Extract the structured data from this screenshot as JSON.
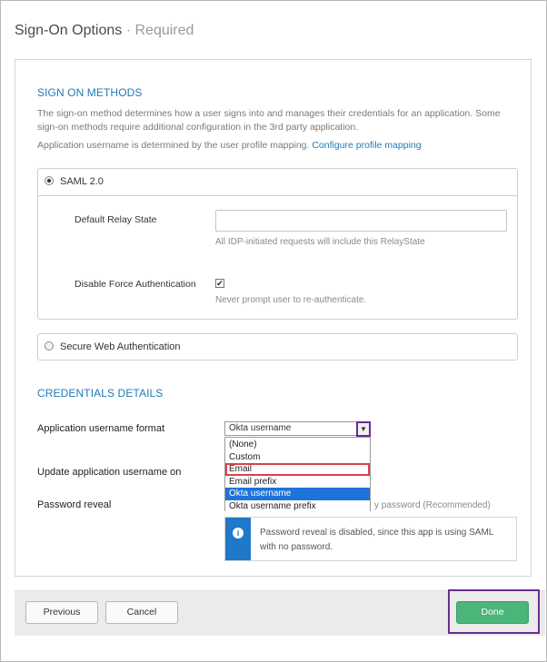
{
  "header": {
    "title": "Sign-On Options",
    "separator": " · ",
    "subtitle": "Required"
  },
  "sign_on_methods": {
    "heading": "SIGN ON METHODS",
    "description": "The sign-on method determines how a user signs into and manages their credentials for an application. Some sign-on methods require additional configuration in the 3rd party application.",
    "username_note": "Application username is determined by the user profile mapping.",
    "configure_link": "Configure profile mapping"
  },
  "saml": {
    "label": "SAML 2.0",
    "selected": true,
    "default_relay_state_label": "Default Relay State",
    "default_relay_state_value": "",
    "relay_state_hint": "All IDP-initiated requests will include this RelayState",
    "disable_force_auth_label": "Disable Force Authentication",
    "disable_force_auth_checked": true,
    "checkbox_mark": "✔",
    "disable_force_auth_hint": "Never prompt user to re-authenticate."
  },
  "swa": {
    "label": "Secure Web Authentication",
    "selected": false
  },
  "credentials": {
    "heading": "CREDENTIALS DETAILS",
    "username_format_label": "Application username format",
    "username_format_value": "Okta username",
    "dropdown_arrow": "▼",
    "options": [
      "(None)",
      "Custom",
      "Email",
      "Email prefix",
      "Okta username",
      "Okta username prefix"
    ],
    "selected_option": "Okta username",
    "highlighted_option": "Email",
    "update_username_label": "Update application username on",
    "password_reveal_label": "Password reveal",
    "password_reveal_partial": "y password (Recommended)",
    "info_icon": "i",
    "info_text": "Password reveal is disabled, since this app is using SAML with no password."
  },
  "footer": {
    "previous_label": "Previous",
    "cancel_label": "Cancel",
    "done_label": "Done"
  },
  "colors": {
    "accent_blue": "#1f7ab8",
    "done_green": "#4bb57a",
    "annotation_purple": "#6a2c91",
    "annotation_red": "#e0404a",
    "selected_blue": "#1e73d8"
  }
}
